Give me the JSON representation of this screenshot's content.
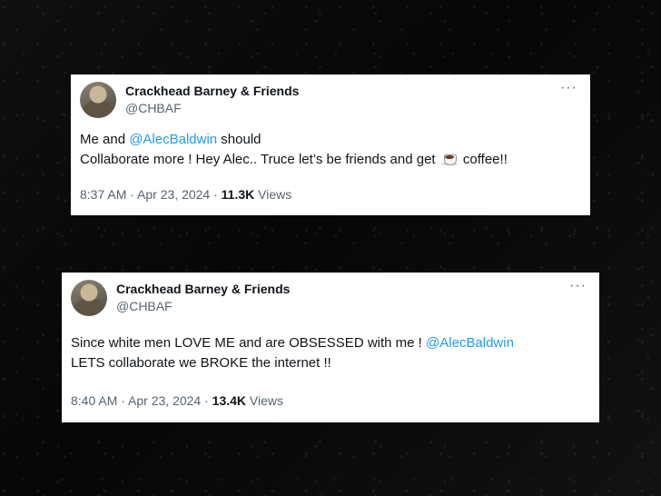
{
  "tweets": [
    {
      "author_name": "Crackhead Barney & Friends",
      "handle": "@CHBAF",
      "more_label": "···",
      "line1_before": "Me and ",
      "line1_mention": "@AlecBaldwin",
      "line1_after": " should",
      "line2_before": "Collaborate more ! Hey Alec.. Truce let’s be friends and get ",
      "line2_icon": "coffee-icon",
      "line2_after": " coffee!!",
      "time": "8:37 AM",
      "separator": " · ",
      "date": "Apr 23, 2024",
      "views_count": "11.3K",
      "views_label": " Views"
    },
    {
      "author_name": "Crackhead Barney & Friends",
      "handle": "@CHBAF",
      "more_label": "···",
      "line1_before": "Since white men LOVE ME and are OBSESSED with me ! ",
      "line1_mention": "@AlecBaldwin",
      "line2_text": "LETS collaborate we BROKE the internet !!",
      "time": "8:40 AM",
      "separator": " · ",
      "date": "Apr 23, 2024",
      "views_count": "13.4K",
      "views_label": " Views"
    }
  ],
  "colors": {
    "mention": "#1d9bf0",
    "secondary_text": "#536471",
    "primary_text": "#0f1419",
    "background": "#0b0b0b"
  }
}
